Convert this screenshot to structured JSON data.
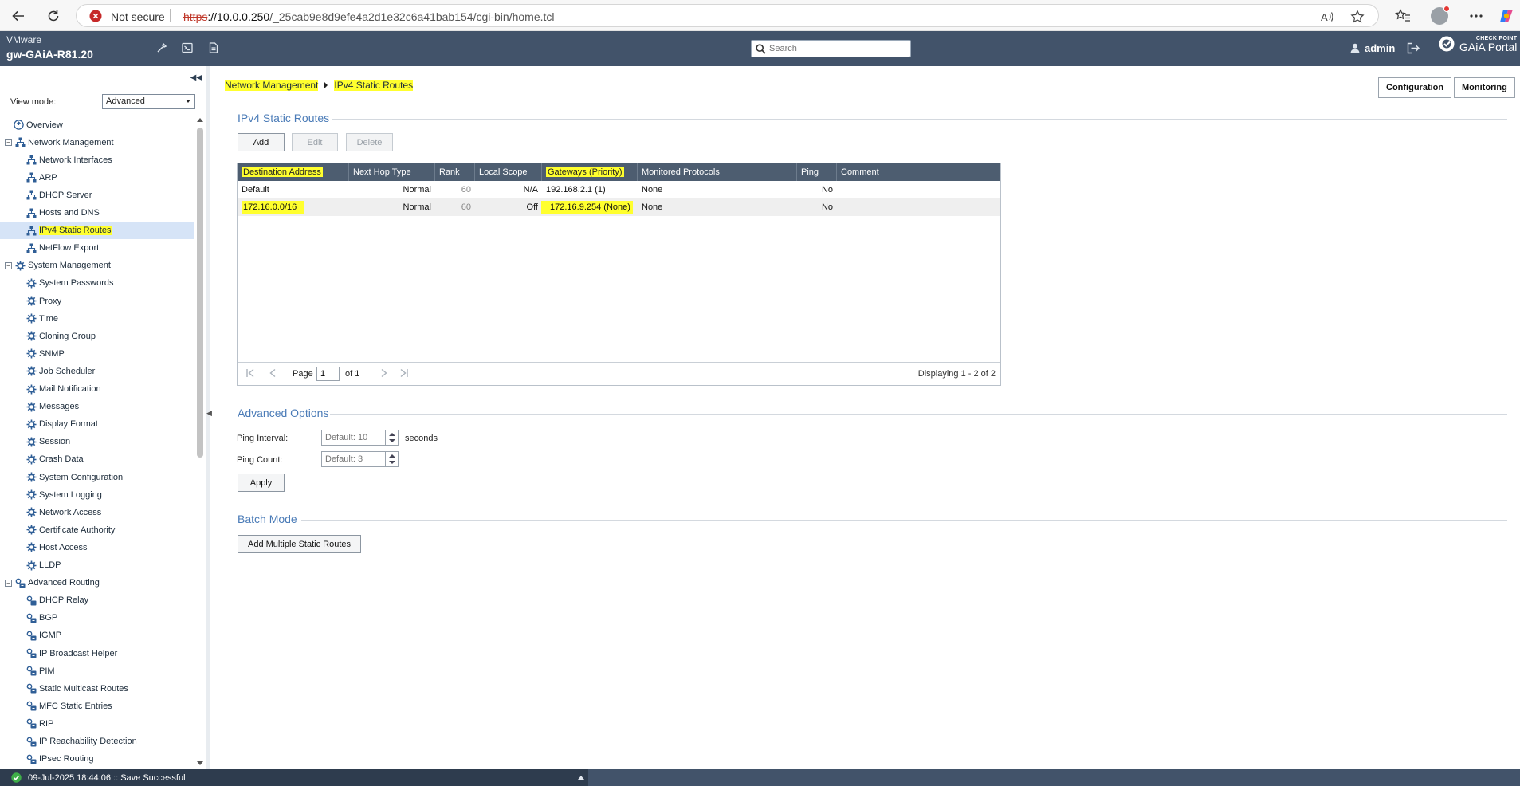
{
  "browser": {
    "security_label": "Not secure",
    "url_scheme": "https",
    "url_host": "://10.0.0.250",
    "url_path": "/_25cab9e8d9efe4a2d1e32c6a41bab154/cgi-bin/home.tcl"
  },
  "header": {
    "platform": "VMware",
    "hostname": "gw-GAiA-R81.20",
    "search_placeholder": "Search",
    "user": "admin",
    "logo_small": "CHECK POINT",
    "logo_big": "GAiA Portal"
  },
  "sidebar": {
    "view_mode_label": "View mode:",
    "view_mode_value": "Advanced",
    "items": [
      {
        "label": "Overview",
        "icon": "overview-icon"
      },
      {
        "label": "Network Management",
        "icon": "network-icon",
        "group": true
      },
      {
        "label": "Network Interfaces",
        "icon": "network-icon"
      },
      {
        "label": "ARP",
        "icon": "network-icon"
      },
      {
        "label": "DHCP Server",
        "icon": "network-icon"
      },
      {
        "label": "Hosts and DNS",
        "icon": "network-icon"
      },
      {
        "label": "IPv4 Static Routes",
        "icon": "network-icon",
        "selected": true
      },
      {
        "label": "NetFlow Export",
        "icon": "network-icon"
      },
      {
        "label": "System Management",
        "icon": "gear-icon",
        "group": true
      },
      {
        "label": "System Passwords",
        "icon": "gear-icon"
      },
      {
        "label": "Proxy",
        "icon": "gear-icon"
      },
      {
        "label": "Time",
        "icon": "gear-icon"
      },
      {
        "label": "Cloning Group",
        "icon": "gear-icon"
      },
      {
        "label": "SNMP",
        "icon": "gear-icon"
      },
      {
        "label": "Job Scheduler",
        "icon": "gear-icon"
      },
      {
        "label": "Mail Notification",
        "icon": "gear-icon"
      },
      {
        "label": "Messages",
        "icon": "gear-icon"
      },
      {
        "label": "Display Format",
        "icon": "gear-icon"
      },
      {
        "label": "Session",
        "icon": "gear-icon"
      },
      {
        "label": "Crash Data",
        "icon": "gear-icon"
      },
      {
        "label": "System Configuration",
        "icon": "gear-icon"
      },
      {
        "label": "System Logging",
        "icon": "gear-icon"
      },
      {
        "label": "Network Access",
        "icon": "gear-icon"
      },
      {
        "label": "Certificate Authority",
        "icon": "gear-icon"
      },
      {
        "label": "Host Access",
        "icon": "gear-icon"
      },
      {
        "label": "LLDP",
        "icon": "gear-icon"
      },
      {
        "label": "Advanced Routing",
        "icon": "routing-icon",
        "group": true
      },
      {
        "label": "DHCP Relay",
        "icon": "routing-icon"
      },
      {
        "label": "BGP",
        "icon": "routing-icon"
      },
      {
        "label": "IGMP",
        "icon": "routing-icon"
      },
      {
        "label": "IP Broadcast Helper",
        "icon": "routing-icon"
      },
      {
        "label": "PIM",
        "icon": "routing-icon"
      },
      {
        "label": "Static Multicast Routes",
        "icon": "routing-icon"
      },
      {
        "label": "MFC Static Entries",
        "icon": "routing-icon"
      },
      {
        "label": "RIP",
        "icon": "routing-icon"
      },
      {
        "label": "IP Reachability Detection",
        "icon": "routing-icon"
      },
      {
        "label": "IPsec Routing",
        "icon": "routing-icon"
      }
    ]
  },
  "main": {
    "breadcrumb": [
      "Network Management",
      "IPv4 Static Routes"
    ],
    "mode_buttons": [
      "Configuration",
      "Monitoring"
    ],
    "routes_title": "IPv4 Static Routes",
    "toolbar": {
      "add": "Add",
      "edit": "Edit",
      "delete": "Delete"
    },
    "columns": [
      "Destination Address",
      "Next Hop Type",
      "Rank",
      "Local Scope",
      "Gateways (Priority)",
      "Monitored Protocols",
      "Ping",
      "Comment"
    ],
    "rows": [
      {
        "destination": "Default",
        "next_hop": "Normal",
        "rank": "60",
        "local_scope": "N/A",
        "gateways": "192.168.2.1 (1)",
        "protocols": "None",
        "ping": "No",
        "comment": ""
      },
      {
        "destination": "172.16.0.0/16",
        "next_hop": "Normal",
        "rank": "60",
        "local_scope": "Off",
        "gateways": "172.16.9.254 (None)",
        "protocols": "None",
        "ping": "No",
        "comment": ""
      }
    ],
    "pagination": {
      "page_label": "Page",
      "page_value": "1",
      "of_label": "of 1",
      "display": "Displaying 1 - 2 of 2"
    },
    "advanced": {
      "title": "Advanced Options",
      "ping_interval_label": "Ping Interval:",
      "ping_interval_placeholder": "Default: 10",
      "ping_interval_unit": "seconds",
      "ping_count_label": "Ping Count:",
      "ping_count_placeholder": "Default: 3",
      "apply": "Apply"
    },
    "batch": {
      "title": "Batch Mode",
      "button": "Add Multiple Static Routes"
    }
  },
  "status": {
    "message": "09-Jul-2025 18:44:06 :: Save Successful"
  },
  "colors": {
    "header": "#42536a",
    "highlight": "#ffff2e",
    "section": "#4a7bb7",
    "selected": "#d6e4f7"
  }
}
